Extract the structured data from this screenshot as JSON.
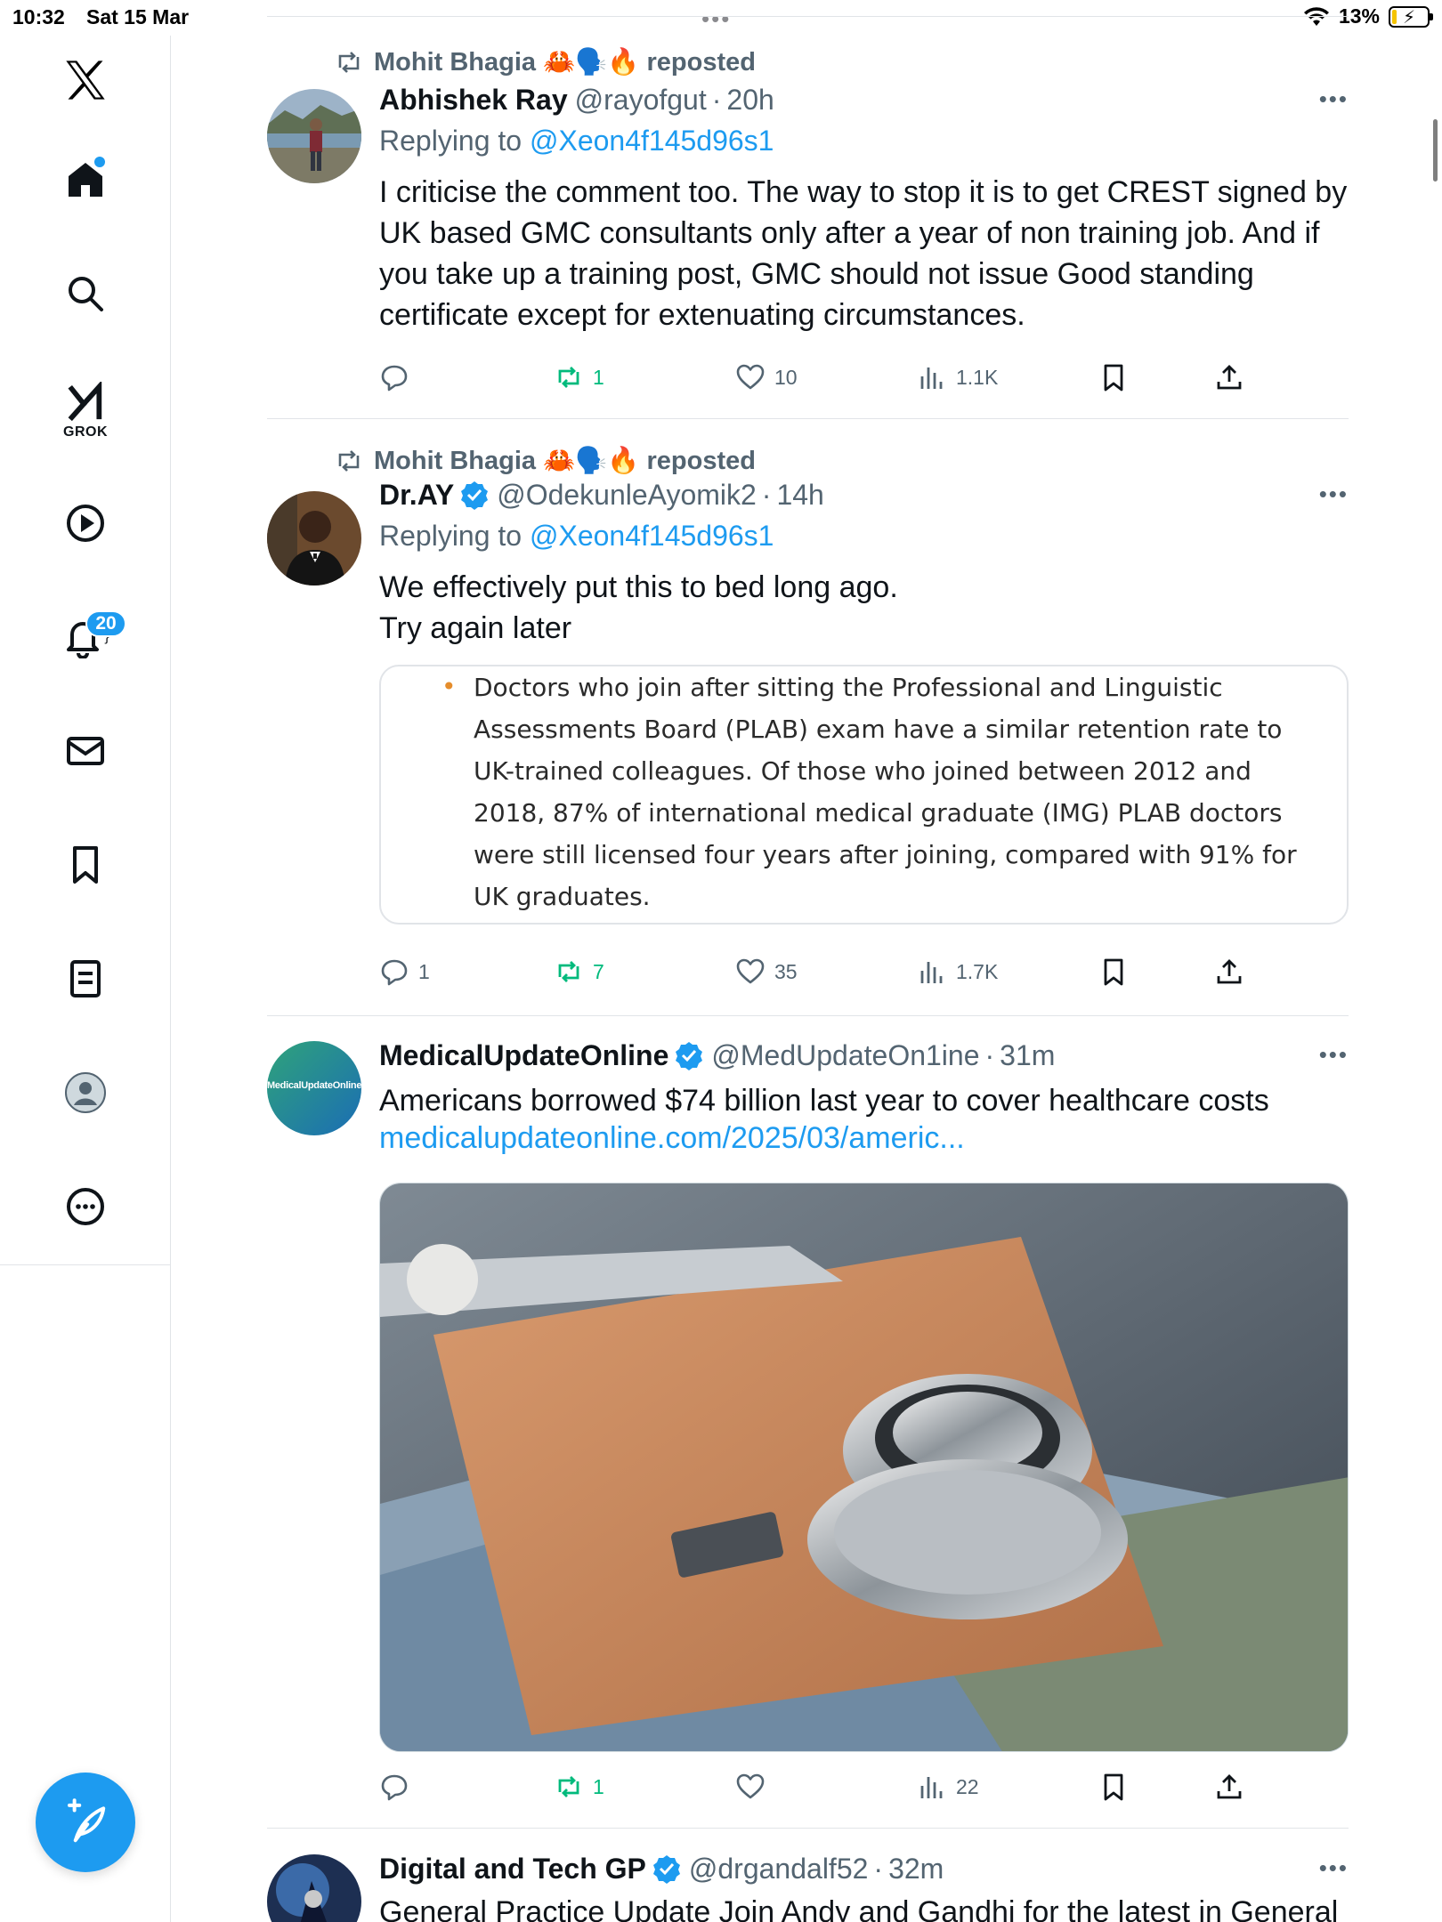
{
  "status": {
    "time": "10:32",
    "date": "Sat 15 Mar",
    "battery": "13%",
    "battery_level": 0.13,
    "multitask_dots": "•••"
  },
  "sidebar": {
    "items": [
      {
        "name": "x-logo",
        "label": "𝕏"
      },
      {
        "name": "home",
        "icon": "home-icon"
      },
      {
        "name": "search",
        "icon": "search-icon"
      },
      {
        "name": "grok",
        "icon": "grok-icon",
        "label": "GROK"
      },
      {
        "name": "video",
        "icon": "play-icon"
      },
      {
        "name": "notifications",
        "icon": "bell-icon",
        "badge": "20"
      },
      {
        "name": "messages",
        "icon": "envelope-icon"
      },
      {
        "name": "bookmarks",
        "icon": "bookmark-icon"
      },
      {
        "name": "lists",
        "icon": "list-icon"
      },
      {
        "name": "profile",
        "icon": "profile-icon"
      },
      {
        "name": "more",
        "icon": "more-icon"
      }
    ],
    "compose_icon": "compose-feather-icon"
  },
  "tweets": [
    {
      "reposted_by": "Mohit Bhagia 🦀🗣️🔥 reposted",
      "name": "Abhishek Ray",
      "handle": "@rayofgut",
      "dot": "·",
      "time": "20h",
      "replying_label": "Replying to",
      "replying_to": "@Xeon4f145d96s1",
      "text": "I criticise the comment too. The way to stop it is to get CREST signed by UK based GMC consultants only after a year of non training job. And if you take up a training post, GMC should not issue Good standing certificate except for extenuating circumstances.",
      "replies": "",
      "reposts": "1",
      "likes": "10",
      "views": "1.1K",
      "more": "•••"
    },
    {
      "reposted_by": "Mohit Bhagia 🦀🗣️🔥 reposted",
      "name": "Dr.AY",
      "verified": true,
      "handle": "@OdekunleAyomik2",
      "dot": "·",
      "time": "14h",
      "replying_label": "Replying to",
      "replying_to": "@Xeon4f145d96s1",
      "text_line1": "We effectively put this to bed long ago.",
      "text_line2": "Try again later",
      "quote_bullet": "•",
      "quote_text": "Doctors who join after sitting the Professional and Linguistic Assessments Board (PLAB) exam have a similar retention rate to UK-trained colleagues. Of those who joined between 2012 and 2018, 87% of international medical graduate (IMG) PLAB doctors were still licensed four years after joining, compared with 91% for UK graduates.",
      "replies": "1",
      "reposts": "7",
      "likes": "35",
      "views": "1.7K",
      "more": "•••"
    },
    {
      "name": "MedicalUpdateOnline",
      "verified": true,
      "handle": "@MedUpdateOn1ine",
      "dot": "·",
      "time": "31m",
      "avatar_text": "MedicalUpdateOnline",
      "text": "Americans borrowed $74 billion last year to cover healthcare costs",
      "link": "medicalupdateonline.com/2025/03/americ...",
      "replies": "",
      "reposts": "1",
      "likes": "",
      "views": "22",
      "more": "•••"
    },
    {
      "name": "Digital and Tech GP",
      "verified": true,
      "handle": "@drgandalf52",
      "dot": "·",
      "time": "32m",
      "text": "General Practice Update Join Andy and Gandhi for the latest in General",
      "more": "•••"
    }
  ],
  "colors": {
    "accent": "#1d9bf0",
    "repost_green": "#00ba7c",
    "muted": "#536471"
  }
}
